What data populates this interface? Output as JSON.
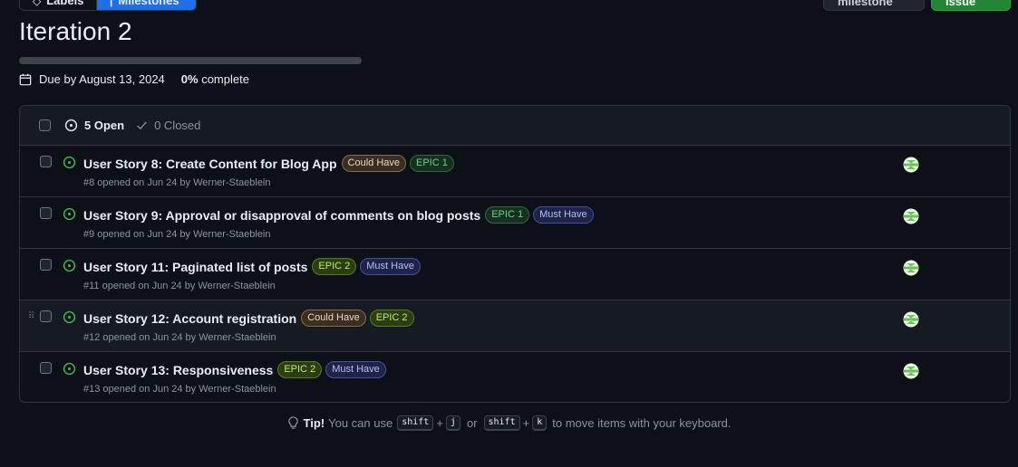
{
  "nav": {
    "labels": "Labels",
    "milestones": "Milestones",
    "edit_milestone": "Edit milestone",
    "new_issue": "New issue"
  },
  "milestone": {
    "title": "Iteration 2",
    "due": "Due by August 13, 2024",
    "percent": "0%",
    "complete_word": "complete",
    "progress_fraction": 0
  },
  "list_header": {
    "open": "5 Open",
    "closed": "0 Closed"
  },
  "issues": [
    {
      "title": "User Story 8: Create Content for Blog App",
      "labels": [
        {
          "text": "Could Have",
          "kind": "could"
        },
        {
          "text": "EPIC 1",
          "kind": "epic1"
        }
      ],
      "meta": "#8 opened on Jun 24 by Werner-Staeblein"
    },
    {
      "title": "User Story 9: Approval or disapproval of comments on blog posts",
      "labels": [
        {
          "text": "EPIC 1",
          "kind": "epic1"
        },
        {
          "text": "Must Have",
          "kind": "must"
        }
      ],
      "meta": "#9 opened on Jun 24 by Werner-Staeblein"
    },
    {
      "title": "User Story 11: Paginated list of posts",
      "labels": [
        {
          "text": "EPIC 2",
          "kind": "epic2"
        },
        {
          "text": "Must Have",
          "kind": "must"
        }
      ],
      "meta": "#11 opened on Jun 24 by Werner-Staeblein"
    },
    {
      "title": "User Story 12: Account registration",
      "labels": [
        {
          "text": "Could Have",
          "kind": "could"
        },
        {
          "text": "EPIC 2",
          "kind": "epic2"
        }
      ],
      "meta": "#12 opened on Jun 24 by Werner-Staeblein"
    },
    {
      "title": "User Story 13: Responsiveness",
      "labels": [
        {
          "text": "EPIC 2",
          "kind": "epic2"
        },
        {
          "text": "Must Have",
          "kind": "must"
        }
      ],
      "meta": "#13 opened on Jun 24 by Werner-Staeblein"
    }
  ],
  "tip": {
    "bold": "Tip!",
    "text1": "You can use",
    "key_shift": "shift",
    "key_j": "j",
    "or": "or",
    "key_k": "k",
    "text2": "to move items with your keyboard."
  },
  "colors": {
    "open_icon": "#3fb950",
    "accent": "#1f6feb"
  }
}
